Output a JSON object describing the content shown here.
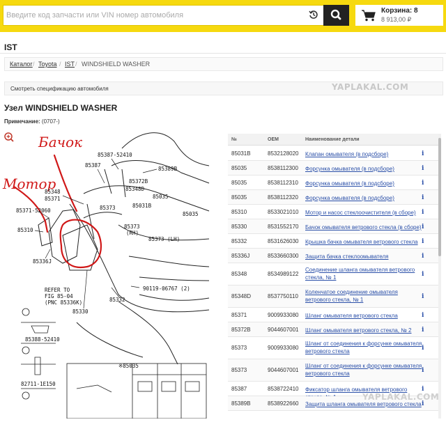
{
  "search": {
    "placeholder": "Введите код запчасти или VIN номер автомобиля"
  },
  "cart": {
    "title": "Корзина: 8",
    "total": "8 913,00 ₽"
  },
  "page_label": "IST",
  "breadcrumb": [
    "Каталог",
    "Toyota",
    "IST",
    "WINDSHIELD WASHER"
  ],
  "spec_label": "Смотреть спецификацию автомобиля",
  "heading": "Узел WINDSHIELD WASHER",
  "note": {
    "label": "Примечание:",
    "value": "(0707-)"
  },
  "diagram": {
    "handwritten": [
      "Бачок",
      "Мотор"
    ],
    "callouts": [
      "85387-52410",
      "85387",
      "85389B",
      "85372B",
      "85348D",
      "85035",
      "85348",
      "85371",
      "85031B",
      "85373",
      "85035",
      "85371-52060",
      "85373",
      "(RH)",
      "85310",
      "85373 (LH)",
      "85336J",
      "85332",
      "90119-06767 (2)",
      "REFER TO",
      "FIG 85-04",
      "(PNC 85336K)",
      "85330",
      "85388-52410",
      "82711-1E150",
      "※85035"
    ],
    "zoom_icon": "zoom-in-icon"
  },
  "table": {
    "headers": [
      "№",
      "OEM",
      "Наименование детали"
    ],
    "rows": [
      {
        "num": "85031B",
        "oem": "8532128020",
        "name": "Клапан омывателя (в подсборе)"
      },
      {
        "num": "85035",
        "oem": "8538112300",
        "name": "Форсунка омывателя (в подсборе)"
      },
      {
        "num": "85035",
        "oem": "8538112310",
        "name": "Форсунка омывателя (в подсборе)"
      },
      {
        "num": "85035",
        "oem": "8538112320",
        "name": "Форсунка омывателя (в подсборе)"
      },
      {
        "num": "85310",
        "oem": "8533021010",
        "name": "Мотор и насос стеклоочистителя (в сборе)"
      },
      {
        "num": "85330",
        "oem": "8531552170",
        "name": "Бачок омывателя ветрового стекла (в сборе)"
      },
      {
        "num": "85332",
        "oem": "8531626030",
        "name": "Крышка бачка омывателя ветрового стекла"
      },
      {
        "num": "85336J",
        "oem": "8533660300",
        "name": "Защита бачка стеклоомывателя"
      },
      {
        "num": "85348",
        "oem": "8534989122",
        "name": "Соединение шланга омывателя ветрового стекла, № 1"
      },
      {
        "num": "85348D",
        "oem": "8537750110",
        "name": "Коленчатое соединение омывателя ветрового стекла, № 1"
      },
      {
        "num": "85371",
        "oem": "9009933080",
        "name": "Шланг омывателя ветрового стекла"
      },
      {
        "num": "85372B",
        "oem": "9044607001",
        "name": "Шланг омывателя ветрового стекла, № 2"
      },
      {
        "num": "85373",
        "oem": "9009933080",
        "name": "Шланг от соединения к форсунке омывателя ветрового стекла"
      },
      {
        "num": "85373",
        "oem": "9044607001",
        "name": "Шланг от соединения к форсунке омывателя ветрового стекла"
      },
      {
        "num": "85387",
        "oem": "8538722410",
        "name": "Фиксатор шланга омывателя ветрового стекла, № 1"
      },
      {
        "num": "85389B",
        "oem": "8538922660",
        "name": "Защита шланга омывателя ветрового стекла"
      }
    ],
    "info_glyph": "i"
  },
  "watermark": "YAPLAKAL.COM",
  "colors": {
    "brand_yellow": "#f6d90f",
    "link_blue": "#2a4fa8",
    "annotation_red": "#d01818"
  }
}
